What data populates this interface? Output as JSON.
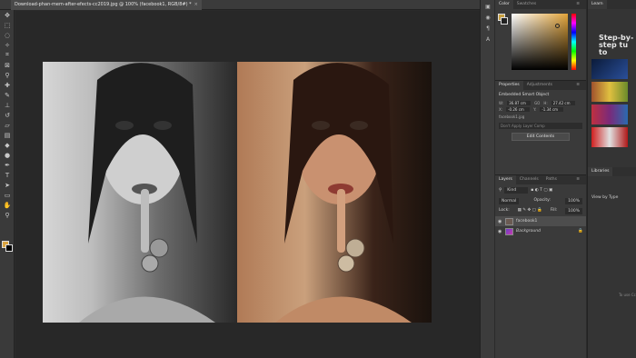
{
  "document": {
    "tab_title": "Download-phan-mem-after-efects-cc2019.jpg @ 100% (facebook1, RGB/8#) *",
    "close_glyph": "×"
  },
  "toolbar": {
    "tools": [
      "move-icon",
      "marquee-icon",
      "lasso-icon",
      "magic-wand-icon",
      "crop-icon",
      "frame-icon",
      "eyedropper-icon",
      "healing-icon",
      "brush-icon",
      "stamp-icon",
      "history-brush-icon",
      "eraser-icon",
      "gradient-icon",
      "blur-icon",
      "dodge-icon",
      "pen-icon",
      "type-icon",
      "path-select-icon",
      "shape-icon",
      "hand-icon",
      "zoom-icon"
    ],
    "foreground_color": "#d9a441",
    "background_color": "#000000"
  },
  "color_panel": {
    "tabs": [
      "Color",
      "Swatches"
    ],
    "fg_color": "#c8a040",
    "bg_color": "#222222"
  },
  "properties": {
    "tabs": [
      "Properties",
      "Adjustments"
    ],
    "title": "Embedded Smart Object",
    "w_label": "W:",
    "w_value": "36.87 cm",
    "go_label": "GO",
    "h_label": "H:",
    "h_value": "27.42 cm",
    "x_label": "X:",
    "x_value": "-0.26 cm",
    "y_label": "Y:",
    "y_value": "-1.34 cm",
    "file_name": "facebook1.jpg",
    "layer_comp": "Don't Apply Layer Comp",
    "edit_button": "Edit Contents"
  },
  "layers": {
    "tabs": [
      "Layers",
      "Channels",
      "Paths"
    ],
    "kind": "Kind",
    "blend_mode": "Normal",
    "opacity_label": "Opacity:",
    "opacity_value": "100%",
    "lock_label": "Lock:",
    "fill_label": "Fill:",
    "fill_value": "100%",
    "items": [
      {
        "name": "facebook1",
        "selected": true
      },
      {
        "name": "Background",
        "selected": false
      }
    ]
  },
  "learn": {
    "tab": "Learn",
    "title": "Step-by-step tu to",
    "libraries_tab": "Libraries",
    "view_by": "View by Type",
    "use_cc": "To use Cc"
  }
}
